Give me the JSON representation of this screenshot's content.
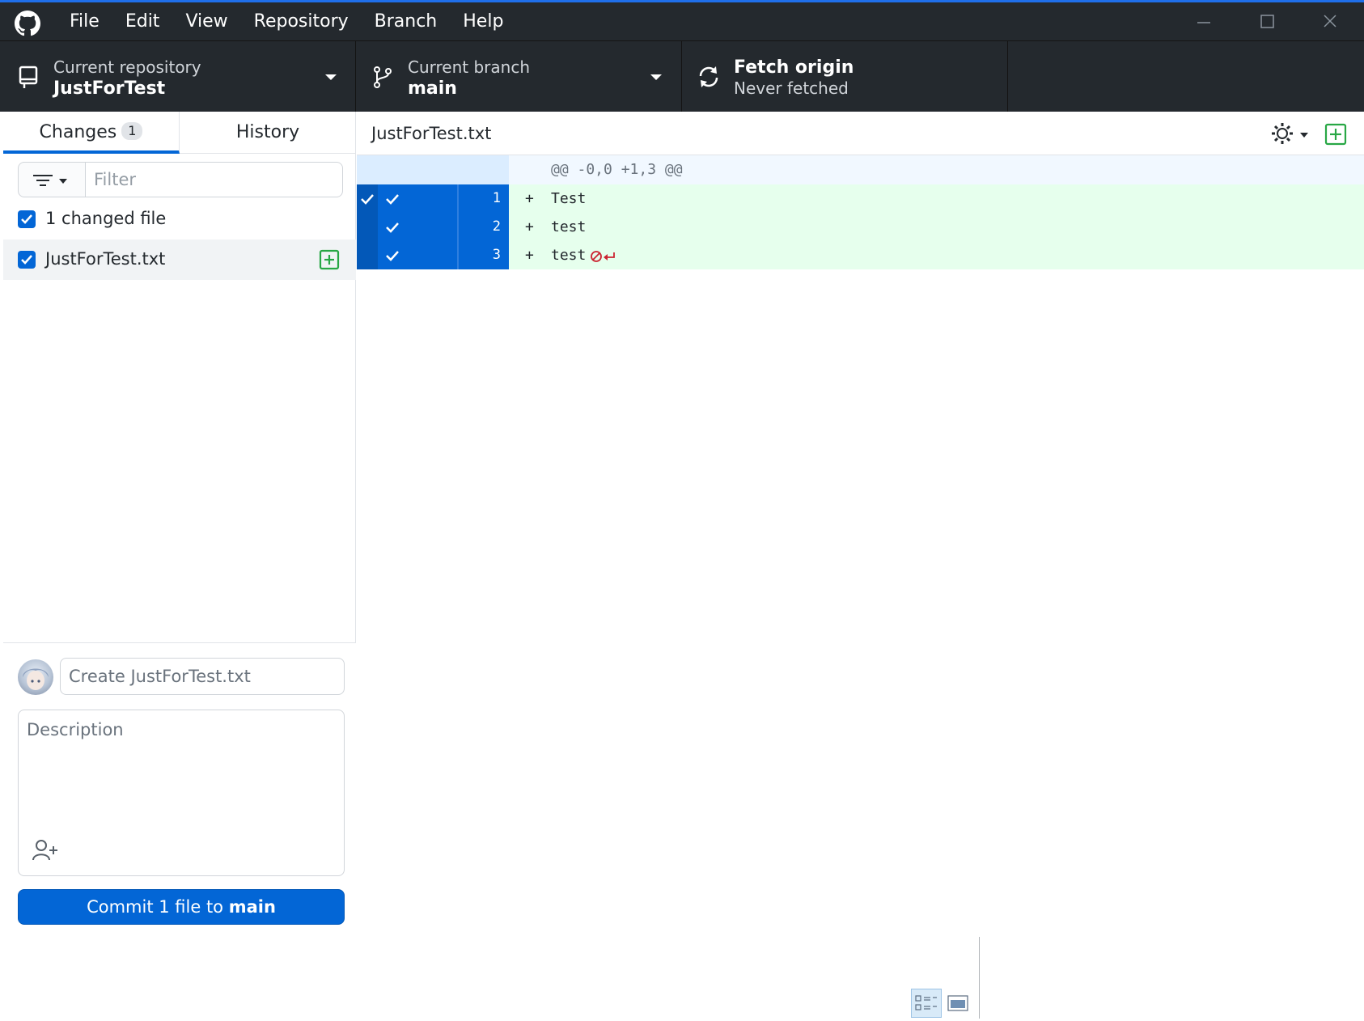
{
  "menu": [
    "File",
    "Edit",
    "View",
    "Repository",
    "Branch",
    "Help"
  ],
  "toolbar": {
    "repo_label": "Current repository",
    "repo_value": "JustForTest",
    "branch_label": "Current branch",
    "branch_value": "main",
    "fetch_label": "Fetch origin",
    "fetch_sub": "Never fetched"
  },
  "sidebar": {
    "tab_changes": "Changes",
    "changes_count": "1",
    "tab_history": "History",
    "filter_placeholder": "Filter",
    "changed_summary": "1 changed file",
    "files": [
      {
        "name": "JustForTest.txt",
        "status": "added",
        "checked": true
      }
    ],
    "summary_placeholder": "Create JustForTest.txt",
    "description_placeholder": "Description",
    "commit_prefix": "Commit 1 file to ",
    "commit_branch": "main"
  },
  "diff": {
    "filename": "JustForTest.txt",
    "hunk_header": "@@ -0,0 +1,3 @@",
    "lines": [
      {
        "num": "1",
        "marker": "+",
        "text": "Test"
      },
      {
        "num": "2",
        "marker": "+",
        "text": "test"
      },
      {
        "num": "3",
        "marker": "+",
        "text": "test"
      }
    ]
  },
  "colors": {
    "accent": "#0366d6",
    "added_bg": "#e6ffed",
    "titlebar": "#24292e",
    "added_icon": "#28a745"
  }
}
